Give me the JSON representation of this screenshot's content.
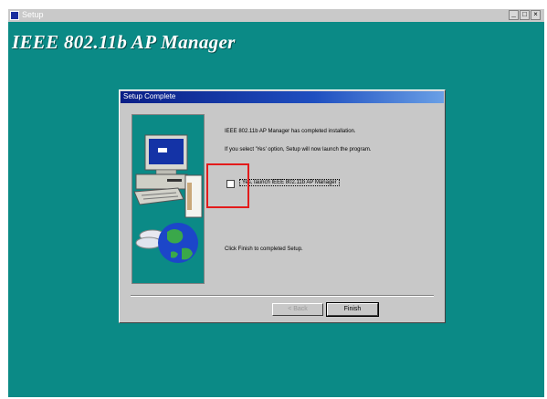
{
  "window": {
    "title": "Setup",
    "minimize_glyph": "_",
    "maximize_glyph": "□",
    "close_glyph": "×"
  },
  "product_title": "IEEE 802.11b AP Manager",
  "dialog": {
    "title": "Setup Complete",
    "message_line1": "IEEE 802.11b AP Manager has completed installation.",
    "message_line2": "If you select 'Yes' option, Setup will now launch the program.",
    "checkbox_label": "Yes, launch IEEE 802.11b AP Manager",
    "checkbox_checked": false,
    "finish_instruction": "Click Finish to completed Setup.",
    "back_button": "< Back",
    "finish_button": "Finish"
  },
  "colors": {
    "background_teal": "#0b8a86",
    "highlight_red": "#e31b1b"
  }
}
